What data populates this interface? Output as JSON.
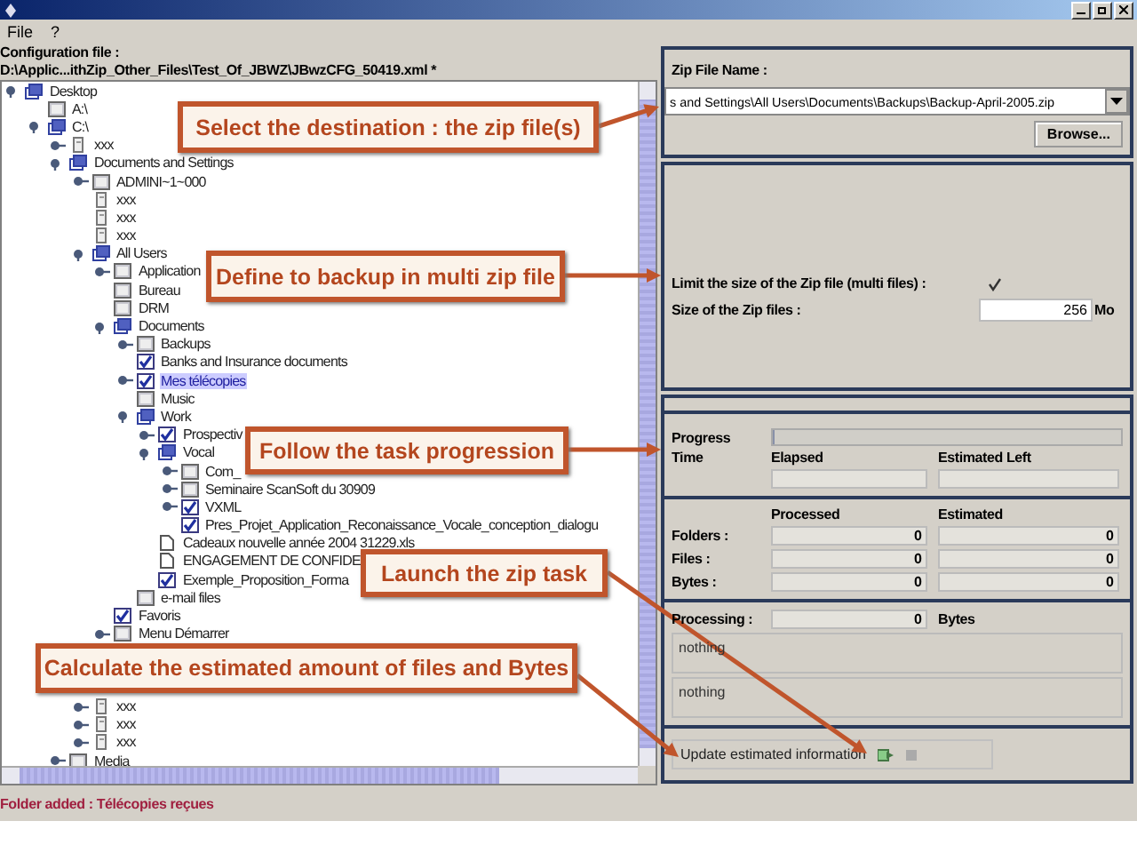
{
  "menu": [
    {
      "label": "File"
    },
    {
      "label": "?"
    }
  ],
  "config": {
    "label": "Configuration file :",
    "path": "D:\\Applic...ithZip_Other_Files\\Test_Of_JBWZ\\JBwzCFG_50419.xml *"
  },
  "tree": [
    {
      "label": "Desktop",
      "kind": "partial",
      "expanded": true,
      "selected": false,
      "children": [
        {
          "label": "A:\\",
          "kind": "empty",
          "selected": false
        },
        {
          "label": "C:\\",
          "kind": "partial",
          "expanded": true,
          "selected": false,
          "children": [
            {
              "label": "xxx",
              "kind": "page",
              "expanded": false,
              "selected": false
            },
            {
              "label": "Documents and Settings",
              "kind": "partial",
              "expanded": true,
              "selected": false,
              "children": [
                {
                  "label": "ADMINI~1~000",
                  "kind": "empty",
                  "expanded": false,
                  "selected": false
                },
                {
                  "label": "xxx",
                  "kind": "page",
                  "selected": false
                },
                {
                  "label": "xxx",
                  "kind": "page",
                  "selected": false
                },
                {
                  "label": "xxx",
                  "kind": "page",
                  "selected": false
                },
                {
                  "label": "All Users",
                  "kind": "partial",
                  "expanded": true,
                  "selected": false,
                  "children": [
                    {
                      "label": "Application",
                      "kind": "empty",
                      "expanded": false,
                      "selected": false
                    },
                    {
                      "label": "Bureau",
                      "kind": "empty",
                      "selected": false
                    },
                    {
                      "label": "DRM",
                      "kind": "empty",
                      "selected": false
                    },
                    {
                      "label": "Documents",
                      "kind": "partial",
                      "expanded": true,
                      "selected": false,
                      "children": [
                        {
                          "label": "Backups",
                          "kind": "empty",
                          "expanded": false,
                          "selected": false
                        },
                        {
                          "label": "Banks and Insurance documents",
                          "kind": "checked",
                          "selected": false
                        },
                        {
                          "label": "Mes télécopies",
                          "kind": "checked",
                          "expanded": false,
                          "selected": true
                        },
                        {
                          "label": "Music",
                          "kind": "empty",
                          "selected": false
                        },
                        {
                          "label": "Work",
                          "kind": "partial",
                          "expanded": true,
                          "selected": false,
                          "children": [
                            {
                              "label": "Prospectiv",
                              "kind": "checked",
                              "expanded": false,
                              "selected": false
                            },
                            {
                              "label": "Vocal",
                              "kind": "partial",
                              "expanded": true,
                              "selected": false,
                              "children": [
                                {
                                  "label": "Com_",
                                  "kind": "empty",
                                  "expanded": false,
                                  "selected": false
                                },
                                {
                                  "label": "Seminaire ScanSoft du 30909",
                                  "kind": "empty",
                                  "expanded": false,
                                  "selected": false
                                },
                                {
                                  "label": "VXML",
                                  "kind": "checked",
                                  "expanded": false,
                                  "selected": false
                                },
                                {
                                  "label": "Pres_Projet_Application_Reconaissance_Vocale_conception_dialogu",
                                  "kind": "checked",
                                  "selected": false
                                }
                              ]
                            },
                            {
                              "label": "Cadeaux nouvelle année 2004 31229.xls",
                              "kind": "file",
                              "selected": false
                            },
                            {
                              "label": "ENGAGEMENT DE CONFIDE",
                              "kind": "file",
                              "selected": false
                            },
                            {
                              "label": "Exemple_Proposition_Forma",
                              "kind": "checked",
                              "selected": false
                            }
                          ]
                        },
                        {
                          "label": "e-mail files",
                          "kind": "empty",
                          "selected": false
                        }
                      ]
                    },
                    {
                      "label": "Favoris",
                      "kind": "checked",
                      "selected": false
                    },
                    {
                      "label": "Menu Démarrer",
                      "kind": "empty",
                      "expanded": false,
                      "selected": false
                    }
                  ]
                },
                {
                  "label": "xxx",
                  "kind": "page",
                  "expanded": false,
                  "selected": false
                },
                {
                  "label": "xxx",
                  "kind": "page",
                  "expanded": false,
                  "selected": false
                },
                {
                  "label": "xxx",
                  "kind": "page",
                  "expanded": false,
                  "selected": false
                }
              ]
            },
            {
              "label": "Media",
              "kind": "empty",
              "expanded": false,
              "selected": false
            }
          ]
        }
      ]
    }
  ],
  "status": "Folder added : Télécopies reçues",
  "zip": {
    "label": "Zip File Name :",
    "value": "s and Settings\\All Users\\Documents\\Backups\\Backup-April-2005.zip",
    "browse": "Browse..."
  },
  "split": {
    "limit_label": "Limit the size of the Zip file (multi files) :",
    "limit_checked": true,
    "size_label": "Size of the Zip files :",
    "size_value": "256",
    "unit": "Mo"
  },
  "progress": {
    "progress_label": "Progress",
    "level": 0,
    "time_label": "Time",
    "elapsed_label": "Elapsed",
    "left_label": "Estimated Left",
    "processed_label": "Processed",
    "estimated_label": "Estimated",
    "rows": [
      {
        "label": "Folders :",
        "processed": "0",
        "estimated": "0"
      },
      {
        "label": "Files :",
        "processed": "0",
        "estimated": "0"
      },
      {
        "label": "Bytes :",
        "processed": "0",
        "estimated": "0"
      }
    ],
    "processing_label": "Processing :",
    "processing_value": "0",
    "bytes_label": "Bytes",
    "messages": [
      "nothing",
      "nothing"
    ],
    "update_button": "Update estimated information"
  },
  "callouts": [
    {
      "text": "Select the destination : the zip file(s)"
    },
    {
      "text": "Define to backup in multi zip file"
    },
    {
      "text": "Follow the task progression"
    },
    {
      "text": "Launch the zip task"
    },
    {
      "text": "Calculate the estimated amount of files and Bytes"
    }
  ]
}
